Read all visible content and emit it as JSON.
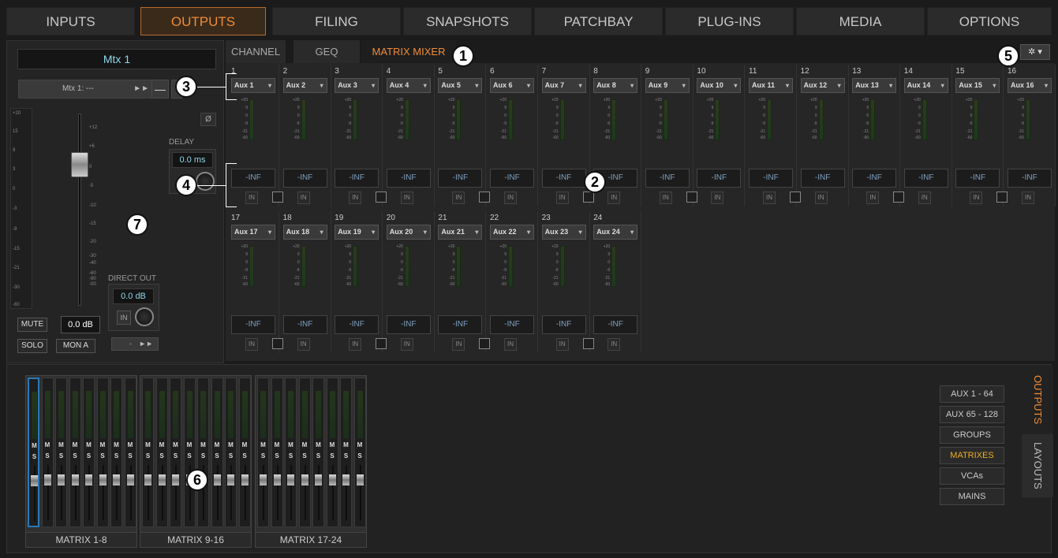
{
  "nav": {
    "tabs": [
      "INPUTS",
      "OUTPUTS",
      "FILING",
      "SNAPSHOTS",
      "PATCHBAY",
      "PLUG-INS",
      "MEDIA",
      "OPTIONS"
    ]
  },
  "left": {
    "name": "Mtx 1",
    "route": "Mtx 1: ---",
    "phase": "Ø",
    "delay_label": "DELAY",
    "delay_value": "0.0 ms",
    "direct_label": "DIRECT OUT",
    "direct_value": "0.0 dB",
    "in_label": "IN",
    "direct_route": "-",
    "mute": "MUTE",
    "gain": "0.0 dB",
    "solo": "SOLO",
    "mona": "MON A",
    "outer_scale": [
      "+20",
      "15",
      "9",
      "3",
      "0",
      "-3",
      "-9",
      "-15",
      "-21",
      "-30",
      "-60"
    ],
    "fader_scale": [
      "+12",
      "+6",
      "0",
      "-5",
      "-10",
      "-15",
      "-20",
      "-30",
      "-40",
      "-60",
      "-90",
      "-00"
    ]
  },
  "subtabs": [
    "CHANNEL",
    "GEQ",
    "MATRIX MIXER"
  ],
  "strips": {
    "nums": [
      "1",
      "2",
      "3",
      "4",
      "5",
      "6",
      "7",
      "8",
      "9",
      "10",
      "11",
      "12",
      "13",
      "14",
      "15",
      "16",
      "17",
      "18",
      "19",
      "20",
      "21",
      "22",
      "23",
      "24"
    ],
    "aux": [
      "Aux 1",
      "Aux 2",
      "Aux 3",
      "Aux 4",
      "Aux 5",
      "Aux 6",
      "Aux 7",
      "Aux 8",
      "Aux 9",
      "Aux 10",
      "Aux 11",
      "Aux 12",
      "Aux 13",
      "Aux 14",
      "Aux 15",
      "Aux 16",
      "Aux 17",
      "Aux 18",
      "Aux 19",
      "Aux 20",
      "Aux 21",
      "Aux 22",
      "Aux 23",
      "Aux 24"
    ],
    "level": "-INF",
    "in": "IN",
    "meter_scale": [
      "+20",
      "9",
      "0",
      "-9",
      "-21",
      "-60"
    ]
  },
  "banks": {
    "labels": [
      "MATRIX 1-8",
      "MATRIX 9-16",
      "MATRIX 17-24"
    ],
    "m": "M",
    "s": "S"
  },
  "bankselect": [
    "AUX 1 - 64",
    "AUX 65 - 128",
    "GROUPS",
    "MATRIXES",
    "VCAs",
    "MAINS"
  ],
  "sidetabs": [
    "OUTPUTS",
    "LAYOUTS"
  ],
  "callouts": [
    "1",
    "2",
    "3",
    "4",
    "5",
    "6",
    "7"
  ],
  "colors": {
    "accent": "#f08c38",
    "selected_bank": "#f0b020",
    "value": "#8fd6e8"
  }
}
